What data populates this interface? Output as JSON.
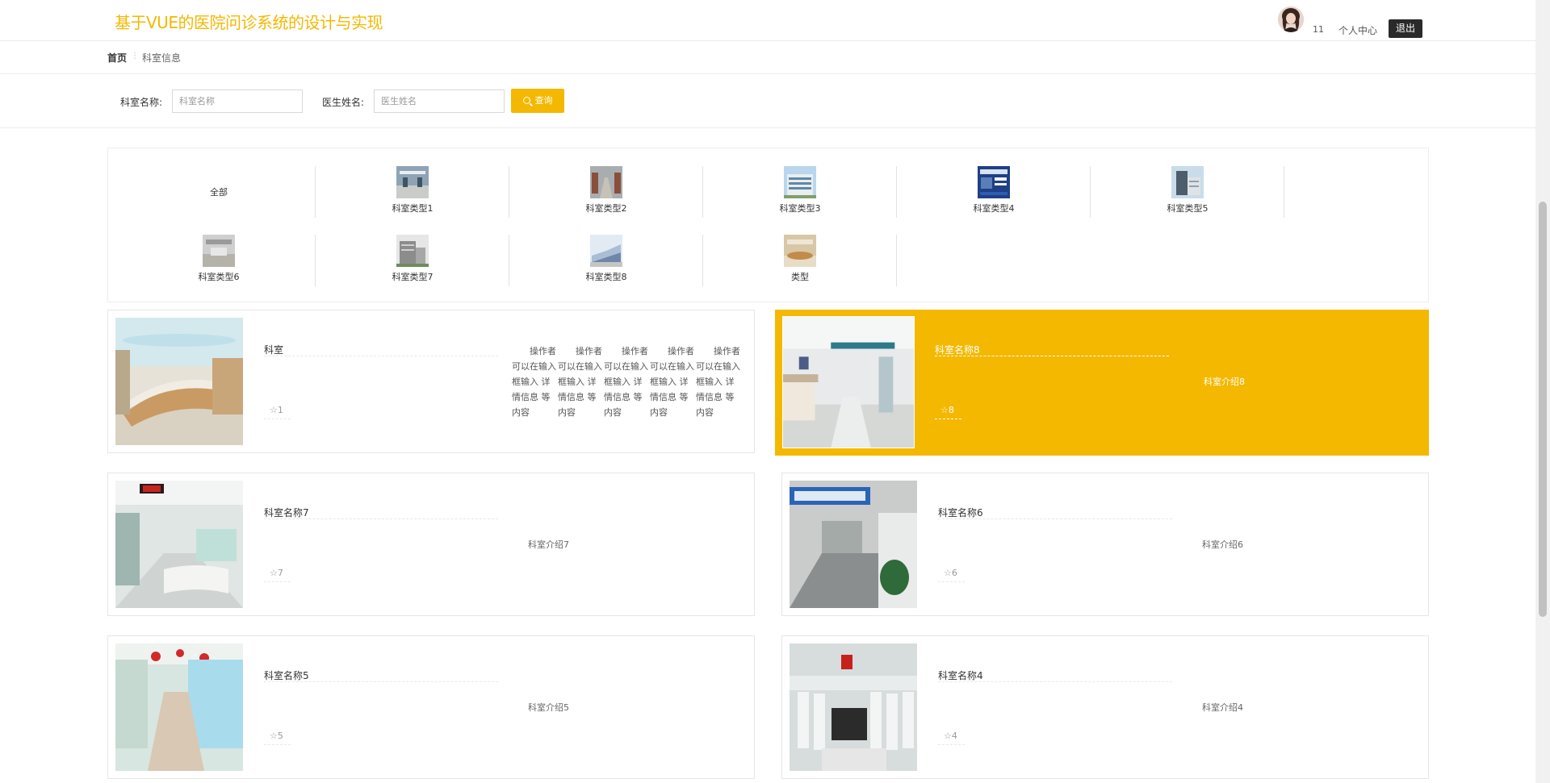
{
  "header": {
    "site_title": "基于VUE的医院问诊系统的设计与实现",
    "user_name": "11",
    "profile_label": "个人中心",
    "logout_label": "退出"
  },
  "breadcrumb": {
    "home": "首页",
    "separator": "⋮",
    "current": "科室信息"
  },
  "search": {
    "dept_label": "科室名称:",
    "dept_placeholder": "科室名称",
    "doctor_label": "医生姓名:",
    "doctor_placeholder": "医生姓名",
    "button_label": "查询"
  },
  "categories": [
    {
      "label": "全部"
    },
    {
      "label": "科室类型1"
    },
    {
      "label": "科室类型2"
    },
    {
      "label": "科室类型3"
    },
    {
      "label": "科室类型4"
    },
    {
      "label": "科室类型5"
    },
    {
      "label": "科室类型6"
    },
    {
      "label": "科室类型7"
    },
    {
      "label": "科室类型8"
    },
    {
      "label": "类型"
    }
  ],
  "departments": [
    {
      "name": "科室",
      "stars": "1",
      "desc_cols": [
        "操作者可以在输入框输入详情信息等内容"
      ]
    },
    {
      "name": "科室名称8",
      "stars": "8",
      "description": "科室介绍8",
      "active": true
    },
    {
      "name": "科室名称7",
      "stars": "7",
      "description": "科室介绍7"
    },
    {
      "name": "科室名称6",
      "stars": "6",
      "description": "科室介绍6"
    },
    {
      "name": "科室名称5",
      "stars": "5",
      "description": "科室介绍5"
    },
    {
      "name": "科室名称4",
      "stars": "4",
      "description": "科室介绍4"
    }
  ],
  "desc_text": {
    "lines": [
      "操作者",
      "可以在输入",
      "框输入 详",
      "情信息 等",
      "内容"
    ]
  },
  "colors": {
    "accent": "#f4b800",
    "dark_button": "#2a2a2a"
  }
}
